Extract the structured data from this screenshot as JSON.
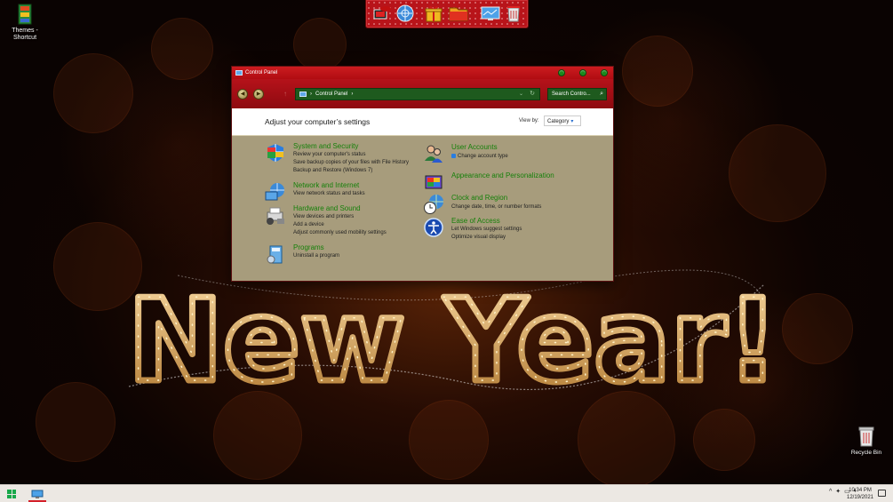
{
  "desktop": {
    "icons": [
      {
        "label": "Themes - Shortcut"
      },
      {
        "label": "Recycle Bin"
      }
    ],
    "wallpaper_text": "New Year!"
  },
  "dock": {
    "items": [
      "pc-icon",
      "internet-icon",
      "gift-icon",
      "folder-icon",
      "monitor-icon",
      "trash-icon"
    ]
  },
  "window": {
    "title": "Control Panel",
    "address": {
      "path": "Control Panel"
    },
    "search": {
      "placeholder": "Search Contro..."
    },
    "heading": "Adjust your computer’s settings",
    "view_by": {
      "label": "View by:",
      "value": "Category"
    },
    "categories": [
      {
        "title": "System and Security",
        "links": [
          "Review your computer's status",
          "Save backup copies of your files with File History",
          "Backup and Restore (Windows 7)"
        ]
      },
      {
        "title": "Network and Internet",
        "links": [
          "View network status and tasks"
        ]
      },
      {
        "title": "Hardware and Sound",
        "links": [
          "View devices and printers",
          "Add a device",
          "Adjust commonly used mobility settings"
        ]
      },
      {
        "title": "Programs",
        "links": [
          "Uninstall a program"
        ]
      },
      {
        "title": "User Accounts",
        "links": [
          "Change account type"
        ]
      },
      {
        "title": "Appearance and Personalization",
        "links": []
      },
      {
        "title": "Clock and Region",
        "links": [
          "Change date, time, or number formats"
        ]
      },
      {
        "title": "Ease of Access",
        "links": [
          "Let Windows suggest settings",
          "Optimize visual display"
        ]
      }
    ],
    "colors": {
      "titlebar": "#b00c12",
      "link_green": "#16800a",
      "body_bg": "#a79c7c"
    }
  },
  "taskbar": {
    "clock": {
      "time": "10:34 PM",
      "date": "12/19/2021"
    }
  }
}
